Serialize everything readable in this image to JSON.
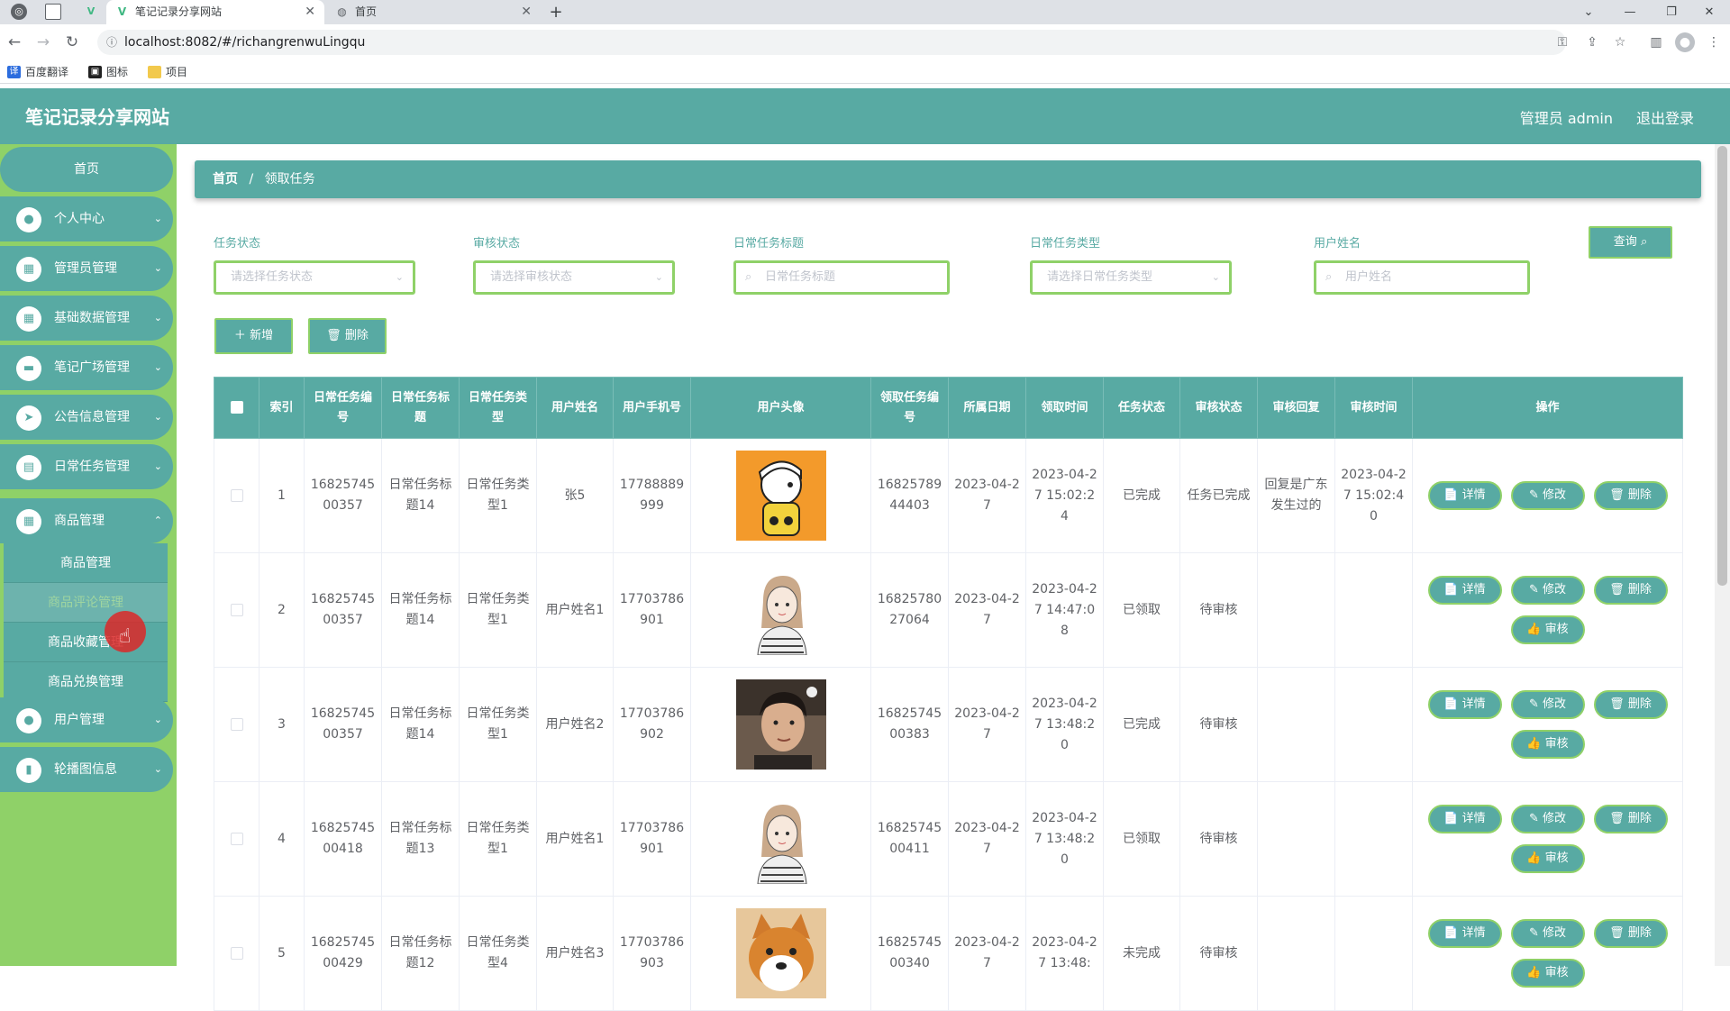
{
  "browser": {
    "tabs": [
      {
        "title": "笔记记录分享网站",
        "active": true
      },
      {
        "title": "首页",
        "active": false
      }
    ],
    "url": "localhost:8082/#/richangrenwuLingqu",
    "bookmarks": [
      "百度翻译",
      "图标",
      "项目"
    ]
  },
  "header": {
    "title": "笔记记录分享网站",
    "admin": "管理员 admin",
    "logout": "退出登录"
  },
  "sidebar": {
    "home": "首页",
    "items": [
      {
        "label": "个人中心",
        "icon": "user-icon"
      },
      {
        "label": "管理员管理",
        "icon": "grid-icon"
      },
      {
        "label": "基础数据管理",
        "icon": "grid-icon"
      },
      {
        "label": "笔记广场管理",
        "icon": "screen-icon"
      },
      {
        "label": "公告信息管理",
        "icon": "send-icon"
      },
      {
        "label": "日常任务管理",
        "icon": "book-icon"
      },
      {
        "label": "商品管理",
        "icon": "grid-icon"
      },
      {
        "label": "用户管理",
        "icon": "user-icon"
      },
      {
        "label": "轮播图信息",
        "icon": "chart-icon"
      }
    ],
    "submenu": [
      "商品管理",
      "商品评论管理",
      "商品收藏管理",
      "商品兑换管理"
    ]
  },
  "breadcrumb": {
    "home": "首页",
    "current": "领取任务"
  },
  "filters": {
    "task_status": {
      "label": "任务状态",
      "placeholder": "请选择任务状态"
    },
    "review_status": {
      "label": "审核状态",
      "placeholder": "请选择审核状态"
    },
    "task_title": {
      "label": "日常任务标题",
      "placeholder": "日常任务标题"
    },
    "task_type": {
      "label": "日常任务类型",
      "placeholder": "请选择日常任务类型"
    },
    "user_name": {
      "label": "用户姓名",
      "placeholder": "用户姓名"
    }
  },
  "buttons": {
    "query": "查询",
    "add": "新增",
    "delete": "删除"
  },
  "table": {
    "headers": [
      "索引",
      "日常任务编号",
      "日常任务标题",
      "日常任务类型",
      "用户姓名",
      "用户手机号",
      "用户头像",
      "领取任务编号",
      "所属日期",
      "领取时间",
      "任务状态",
      "审核状态",
      "审核回复",
      "审核时间",
      "操作"
    ],
    "actions": {
      "detail": "详情",
      "edit": "修改",
      "delete": "删除",
      "review": "审核"
    },
    "rows": [
      {
        "index": "1",
        "task_no": "1682574500357",
        "title": "日常任务标题14",
        "type": "日常任务类型1",
        "user": "张5",
        "phone": "17788889999",
        "avatar": "cartoon-boy",
        "claim_no": "1682578944403",
        "date": "2023-04-27",
        "claim_time": "2023-04-27 15:02:24",
        "task_status": "已完成",
        "review_status": "任务已完成",
        "reply": "回复是广东发生过的",
        "review_time": "2023-04-27 15:02:40",
        "can_review": false
      },
      {
        "index": "2",
        "task_no": "1682574500357",
        "title": "日常任务标题14",
        "type": "日常任务类型1",
        "user": "用户姓名1",
        "phone": "17703786901",
        "avatar": "sketch-girl",
        "claim_no": "1682578027064",
        "date": "2023-04-27",
        "claim_time": "2023-04-27 14:47:08",
        "task_status": "已领取",
        "review_status": "待审核",
        "reply": "",
        "review_time": "",
        "can_review": true
      },
      {
        "index": "3",
        "task_no": "1682574500357",
        "title": "日常任务标题14",
        "type": "日常任务类型1",
        "user": "用户姓名2",
        "phone": "17703786902",
        "avatar": "photo-man",
        "claim_no": "1682574500383",
        "date": "2023-04-27",
        "claim_time": "2023-04-27 13:48:20",
        "task_status": "已完成",
        "review_status": "待审核",
        "reply": "",
        "review_time": "",
        "can_review": true
      },
      {
        "index": "4",
        "task_no": "1682574500418",
        "title": "日常任务标题13",
        "type": "日常任务类型1",
        "user": "用户姓名1",
        "phone": "17703786901",
        "avatar": "sketch-girl",
        "claim_no": "1682574500411",
        "date": "2023-04-27",
        "claim_time": "2023-04-27 13:48:20",
        "task_status": "已领取",
        "review_status": "待审核",
        "reply": "",
        "review_time": "",
        "can_review": true
      },
      {
        "index": "5",
        "task_no": "1682574500429",
        "title": "日常任务标题12",
        "type": "日常任务类型4",
        "user": "用户姓名3",
        "phone": "17703786903",
        "avatar": "shiba-dog",
        "claim_no": "1682574500340",
        "date": "2023-04-27",
        "claim_time": "2023-04-27 13:48:",
        "task_status": "未完成",
        "review_status": "待审核",
        "reply": "",
        "review_time": "",
        "can_review": true
      }
    ]
  },
  "colors": {
    "primary": "#58aaa3",
    "sidebar_bg": "#8fd168",
    "border_accent": "#8fd168"
  }
}
